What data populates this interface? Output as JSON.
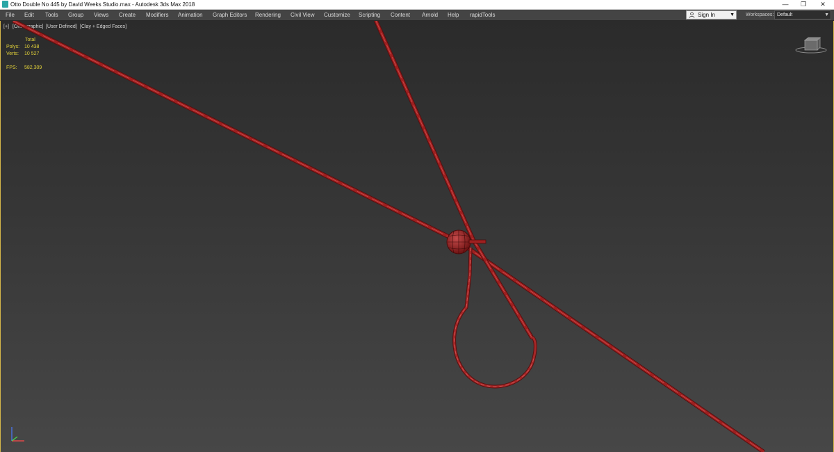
{
  "window": {
    "title": "Otto Double No 445 by David Weeks Studio.max - Autodesk 3ds Max 2018",
    "controls": {
      "minimize": "—",
      "restore": "❐",
      "close": "✕"
    }
  },
  "menu": {
    "items": [
      "File",
      "Edit",
      "Tools",
      "Group",
      "Views",
      "Create",
      "Modifiers",
      "Animation",
      "Graph Editors",
      "Rendering",
      "Civil View",
      "Customize",
      "Scripting",
      "Content",
      "Arnold",
      "Help",
      "rapidTools"
    ],
    "sign_in": "Sign In",
    "workspaces_label": "Workspaces:",
    "workspaces_value": "Default"
  },
  "viewport": {
    "labels": [
      "[+]",
      "[Orthographic]",
      "[User Defined]",
      "[Clay + Edged Faces]"
    ],
    "stats": {
      "header": "Total",
      "polys_label": "Polys:",
      "polys_value": "10 438",
      "verts_label": "Verts:",
      "verts_value": "10 527",
      "fps_label": "FPS:",
      "fps_value": "582,309"
    }
  },
  "colors": {
    "viewport_bg": "#3a3a3a",
    "wire": "#8b1a1a",
    "wire_highlight": "#b83a3a",
    "stats_text": "#e3d23a",
    "active_border": "#d7b84a"
  },
  "icons": {
    "app": "3ds-max-icon",
    "user": "user-icon",
    "dropdown": "chevron-down-icon",
    "viewcube": "viewcube-icon",
    "axis": "axis-tripod-icon"
  }
}
